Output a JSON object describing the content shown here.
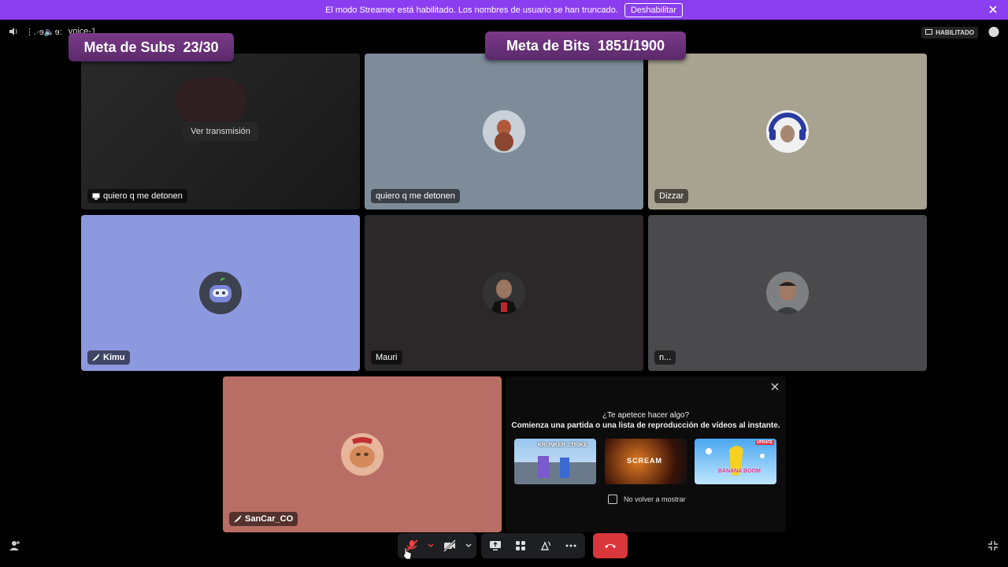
{
  "banner": {
    "text": "El modo Streamer está habilitado. Los nombres de usuario se han truncado.",
    "button": "Deshabilitar"
  },
  "topbar": {
    "channel": "voice-1",
    "channel_prefix": "⋮.·ɘ🔈ɘ:",
    "badge": "HABILITADO"
  },
  "overlays": {
    "subs_goal": "Meta de Subs  23/30",
    "bits_goal": "Meta de Bits  1851/1900"
  },
  "tiles": [
    {
      "name": "quiero q me detonen",
      "stream_button": "Ver transmisión",
      "bg": "#222"
    },
    {
      "name": "quiero q me detonen",
      "bg": "#7e8c99"
    },
    {
      "name": "Dizzar",
      "bg": "#a8a390"
    },
    {
      "name": "Kimu",
      "bg": "#8d99de"
    },
    {
      "name": "Mauri",
      "bg": "#2c2829"
    },
    {
      "name": "n...",
      "bg": "#4a4a4c"
    },
    {
      "name": "SanCar_CO",
      "bg": "#b86e65"
    }
  ],
  "activity_panel": {
    "title": "¿Te apetece hacer algo?",
    "subtitle": "Comienza una partida o una lista de reproducción de vídeos al instante.",
    "games": [
      "KRUNKER STRIKE",
      "SCREAM",
      "BANANA BOOM"
    ],
    "update_badge": "UPDATE",
    "checkbox_label": "No volver a mostrar"
  }
}
